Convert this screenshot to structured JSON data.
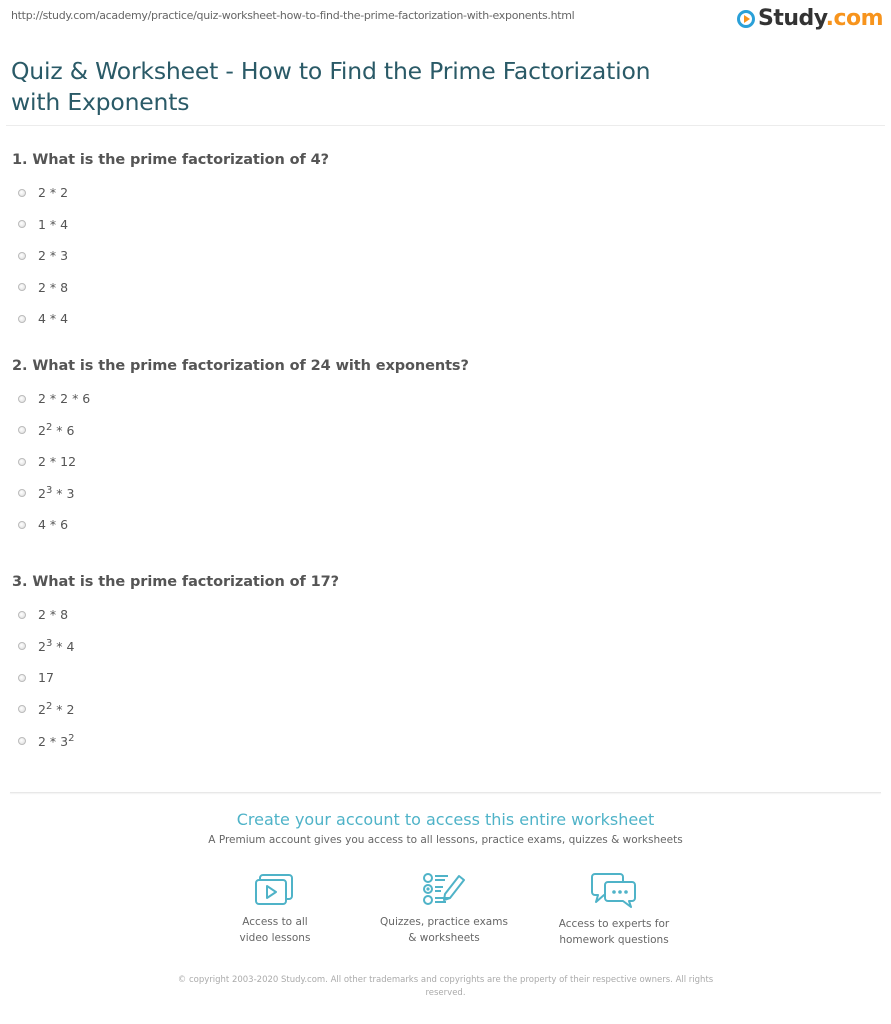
{
  "page": {
    "url": "http://study.com/academy/practice/quiz-worksheet-how-to-find-the-prime-factorization-with-exponents.html",
    "logo": {
      "name": "Study",
      "suffix": ".com",
      "accent": "#f7941d",
      "mark_color": "#2aa0d8"
    },
    "title": "Quiz & Worksheet - How to Find the Prime Factorization with Exponents"
  },
  "questions": [
    {
      "text": "1. What is the prime factorization of 4?",
      "options": [
        {
          "base": "2 * 2",
          "sup": "",
          "tail": ""
        },
        {
          "base": "1 * 4",
          "sup": "",
          "tail": ""
        },
        {
          "base": "2 * 3",
          "sup": "",
          "tail": ""
        },
        {
          "base": "2 * 8",
          "sup": "",
          "tail": ""
        },
        {
          "base": "4 * 4",
          "sup": "",
          "tail": ""
        }
      ]
    },
    {
      "text": "2. What is the prime factorization of 24 with exponents?",
      "options": [
        {
          "base": "2 * 2 * 6",
          "sup": "",
          "tail": ""
        },
        {
          "base": "2",
          "sup": "2",
          "tail": " * 6"
        },
        {
          "base": "2 * 12",
          "sup": "",
          "tail": ""
        },
        {
          "base": "2",
          "sup": "3",
          "tail": " * 3"
        },
        {
          "base": "4 * 6",
          "sup": "",
          "tail": ""
        }
      ]
    },
    {
      "text": "3. What is the prime factorization of 17?",
      "options": [
        {
          "base": "2 * 8",
          "sup": "",
          "tail": ""
        },
        {
          "base": "2",
          "sup": "3",
          "tail": " * 4"
        },
        {
          "base": "17",
          "sup": "",
          "tail": ""
        },
        {
          "base": "2",
          "sup": "2",
          "tail": " * 2"
        },
        {
          "base": "2 * 3",
          "sup": "2",
          "tail": ""
        }
      ]
    }
  ],
  "promo": {
    "title": "Create your account to access this entire worksheet",
    "subtitle": "A Premium account gives you access to all lessons, practice exams, quizzes & worksheets",
    "accent": "#4fb3c8",
    "features": [
      {
        "icon": "video-lessons-icon",
        "line1": "Access to all",
        "line2": "video lessons"
      },
      {
        "icon": "quiz-checklist-icon",
        "line1": "Quizzes, practice exams",
        "line2": "& worksheets"
      },
      {
        "icon": "chat-bubbles-icon",
        "line1": "Access to experts for",
        "line2": "homework questions"
      }
    ]
  },
  "footer": {
    "copyright": "© copyright 2003-2020 Study.com. All other trademarks and copyrights are the property of their respective owners. All rights reserved."
  }
}
